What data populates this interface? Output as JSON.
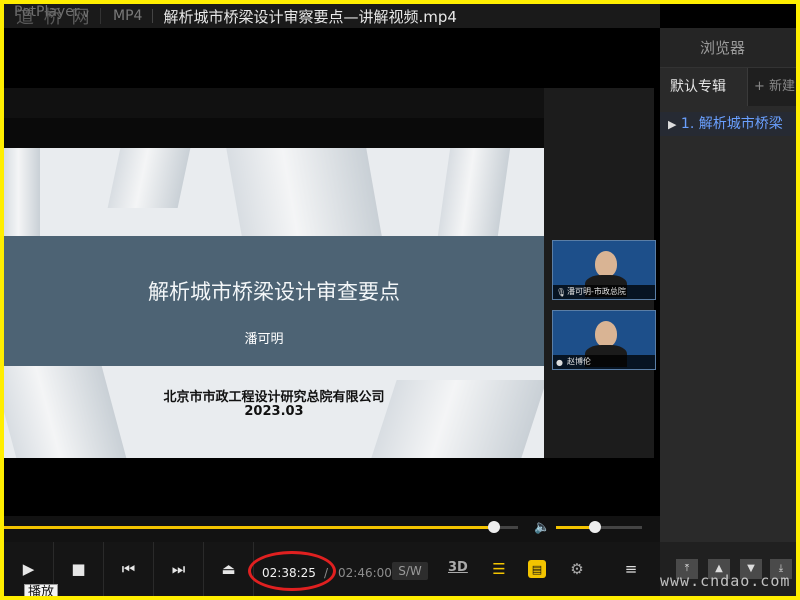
{
  "app": {
    "brand": "PotPlayer",
    "brand_watermark": "道 桥 网",
    "format": "MP4",
    "title": "解析城市桥梁设计审察要点—讲解视频.mp4"
  },
  "slide": {
    "title": "解析城市桥梁设计审查要点",
    "author": "潘可明",
    "organization": "北京市市政工程设计研究总院有限公司",
    "date": "2023.03"
  },
  "cams": [
    {
      "label": "潘可明-市政总院"
    },
    {
      "label": "赵博伦"
    }
  ],
  "playback": {
    "current_time": "02:38:25",
    "separator": "/",
    "total_time": "02:46:00",
    "progress": 0.954,
    "volume": 0.45,
    "sw_label": "S/W",
    "btn_3d": "3D",
    "tooltip": "播放"
  },
  "panel": {
    "header": "浏览器",
    "tab_active": "默认专辑",
    "tab_new": "+ 新建",
    "playlist": [
      {
        "label": "1. 解析城市桥梁"
      }
    ]
  },
  "watermark": "www.cndao.com",
  "colors": {
    "frame": "#ffee00",
    "accent": "#f3c400",
    "ring": "#e02020",
    "banner": "#4d6374",
    "link": "#6aa0ff"
  },
  "icons": [
    "play-icon",
    "stop-icon",
    "prev-icon",
    "next-icon",
    "eject-icon",
    "volume-icon",
    "search-list-icon",
    "subtitle-icon",
    "gear-icon",
    "menu-icon",
    "mic-icon"
  ]
}
